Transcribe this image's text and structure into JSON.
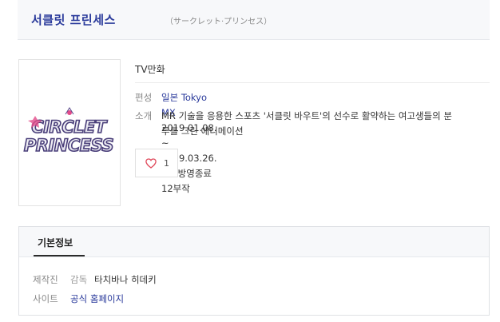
{
  "header": {
    "title": "서클릿 프린세스",
    "subtitle": "（サークレット·プリンセス）"
  },
  "poster": {
    "logo_line1": "CIRCLET",
    "logo_line2": "PRINCESS",
    "colors": {
      "fill": "#f3f3f6",
      "stroke": "#5a4a8c",
      "accent": "#e24b8a"
    }
  },
  "info": {
    "category": "TV만화",
    "broadcast": {
      "label": "편성",
      "network": "일본 Tokyo MX",
      "period": "2019.01.08. ~ 2019.03.26.",
      "status": "방영종료 12부작"
    },
    "summary": {
      "label": "소개",
      "line1": "MR 기술을 응용한 스포츠 '서클릿 바우트'의 선수로 활약하는 여고생들의 분",
      "line2": "투를 그린 애니메이션"
    },
    "like": {
      "count": "1",
      "icon": "heart-icon"
    }
  },
  "basic": {
    "tab": "기본정보",
    "production": {
      "label": "제작진",
      "role": "감독",
      "name": "타치바나 히데키"
    },
    "site": {
      "label": "사이트",
      "link": "공식 홈페이지"
    }
  },
  "colors": {
    "brand": "#2a3a9b",
    "heart": "#e0485a"
  }
}
